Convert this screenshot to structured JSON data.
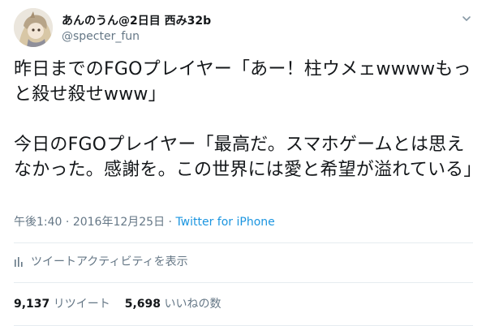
{
  "author": {
    "display_name": "あんのうん@2日目 西み32b",
    "handle": "@specter_fun",
    "avatar_icon": "avatar-illustration"
  },
  "menu": {
    "icon": "chevron-down-icon"
  },
  "tweet": {
    "paragraph_1": "昨日までのFGOプレイヤー「あー！柱ウメェwwwwもっと殺せ殺せwww」",
    "paragraph_2": "今日のFGOプレイヤー「最高だ。スマホゲームとは思えなかった。感謝を。この世界には愛と希望が溢れている」"
  },
  "meta": {
    "time": "午後1:40",
    "separator_1": " · ",
    "date": "2016年12月25日",
    "separator_2": " · ",
    "source": "Twitter for iPhone"
  },
  "activity": {
    "label": "ツイートアクティビティを表示",
    "icon": "bar-chart-icon"
  },
  "stats": {
    "retweets_count": "9,137",
    "retweets_label": "リツイート",
    "likes_count": "5,698",
    "likes_label": "いいねの数"
  },
  "colors": {
    "text": "#14171a",
    "secondary": "#657786",
    "link": "#1b95e0",
    "divider": "#e6ecf0"
  }
}
